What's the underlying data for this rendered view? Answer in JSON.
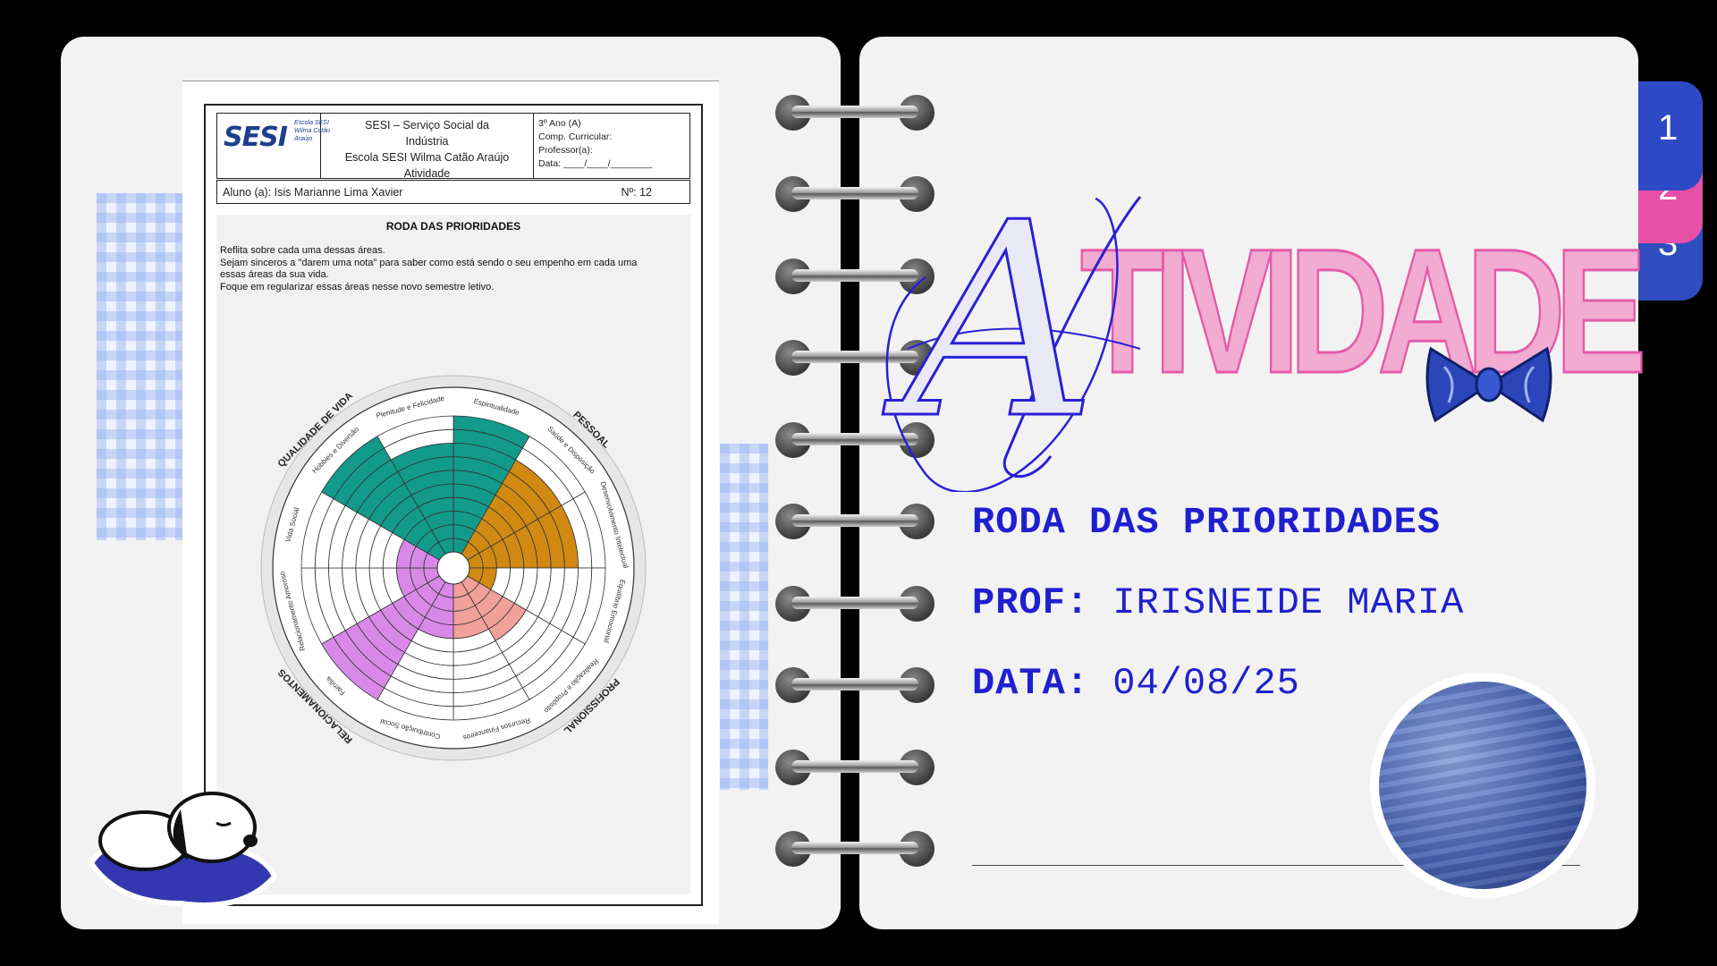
{
  "worksheet": {
    "logo": "SESI",
    "logo_sub": "Escola SESI Wilma Catão Araújo",
    "school_lines": [
      "SESI – Serviço Social da",
      "Indústria",
      "Escola SESI Wilma Catão Araújo",
      "Atividade"
    ],
    "info_lines": [
      "3º Ano (A)",
      "Comp. Curricular:",
      "Professor(a):",
      "Data: ____/____/________"
    ],
    "student": "Aluno (a): Isis Marianne Lima Xavier",
    "number": "Nº: 12",
    "body_title": "RODA DAS PRIORIDADES",
    "instructions": "Reflita sobre cada uma dessas áreas.\nSejam sinceros a \"darem uma nota\" para saber como está sendo o seu empenho em cada uma\nessas áreas da sua vida.\nFoque em regularizar essas áreas nesse novo semestre letivo.",
    "wheel": {
      "groups": [
        "QUALIDADE DE VIDA",
        "PESSOAL",
        "PROFISSIONAL",
        "RELACIONAMENTOS"
      ],
      "areas": [
        "Espiritualidade",
        "Saúde e Disposição",
        "Desenvolvimento Intelectual",
        "Equilíbrio Emocional",
        "Realização e Propósito",
        "Recursos Financeiros",
        "Contribuição Social",
        "Família",
        "Relacionamento Amoroso",
        "Vida Social",
        "Hobbies e Diversão",
        "Plenitude e Felicidade"
      ],
      "scores": [
        10,
        8,
        8,
        2,
        5,
        4,
        4,
        10,
        3,
        3,
        10,
        8
      ],
      "colors": [
        "#129a8a",
        "#d08a12",
        "#d08a12",
        "#d08a12",
        "#f2a09a",
        "#f2a09a",
        "#d889e8",
        "#d889e8",
        "#d889e8",
        "#d889e8",
        "#129a8a",
        "#129a8a"
      ]
    }
  },
  "tabs": [
    "1",
    "2",
    "3"
  ],
  "title": {
    "initial": "A",
    "rest": "TIVIDADE"
  },
  "info": {
    "activity": "RODA DAS PRIORIDADES",
    "prof_label": "PROF:",
    "prof_value": "IRISNEIDE MARIA",
    "date_label": "DATA:",
    "date_value": "04/08/25"
  },
  "colors": {
    "accent_blue": "#1f1fcf",
    "accent_pink": "#e45aa8",
    "tab_blue": "#2e49c6",
    "tab_pink": "#e84fa6"
  },
  "icons": [
    "bow-tie-icon",
    "planet-neptune-icon",
    "sleeping-snoopy-icon"
  ]
}
